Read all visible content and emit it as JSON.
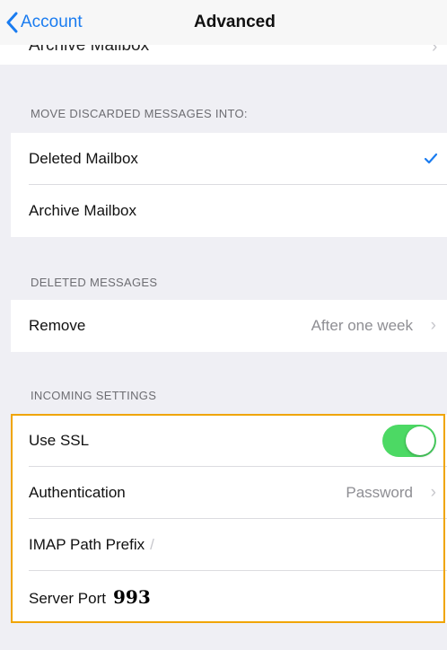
{
  "navbar": {
    "back_label": "Account",
    "title": "Advanced"
  },
  "clipped_row": {
    "label": "Archive Mailbox"
  },
  "sections": {
    "move_discarded": {
      "header": "MOVE DISCARDED MESSAGES INTO:",
      "rows": [
        {
          "label": "Deleted Mailbox",
          "selected": true
        },
        {
          "label": "Archive Mailbox",
          "selected": false
        }
      ]
    },
    "deleted_messages": {
      "header": "DELETED MESSAGES",
      "remove": {
        "label": "Remove",
        "value": "After one week"
      }
    },
    "incoming_settings": {
      "header": "INCOMING SETTINGS",
      "use_ssl": {
        "label": "Use SSL",
        "enabled": true
      },
      "authentication": {
        "label": "Authentication",
        "value": "Password"
      },
      "imap_path_prefix": {
        "label": "IMAP Path Prefix",
        "value": "/"
      },
      "server_port": {
        "label": "Server Port",
        "value": "993"
      }
    }
  },
  "colors": {
    "accent_blue": "#1a7cf0",
    "toggle_on": "#4cd964",
    "highlight": "#f0a500"
  }
}
